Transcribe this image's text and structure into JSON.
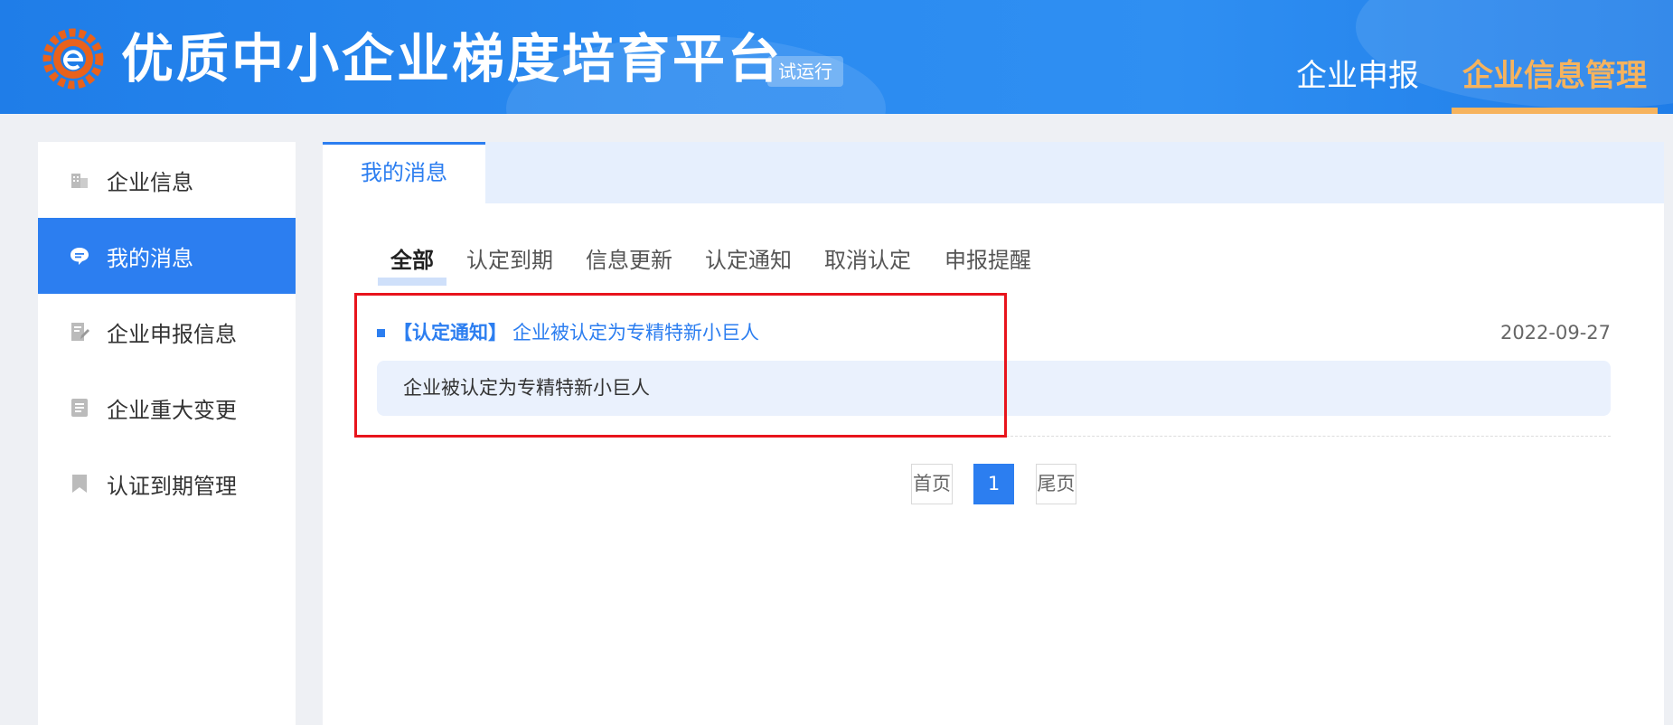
{
  "header": {
    "site_title": "优质中小企业梯度培育平台",
    "trial_badge": "试运行",
    "nav": [
      {
        "label": "企业申报",
        "active": false
      },
      {
        "label": "企业信息管理",
        "active": true
      }
    ]
  },
  "sidebar": {
    "items": [
      {
        "label": "企业信息",
        "icon": "building-icon",
        "active": false
      },
      {
        "label": "我的消息",
        "icon": "message-icon",
        "active": true
      },
      {
        "label": "企业申报信息",
        "icon": "edit-document-icon",
        "active": false
      },
      {
        "label": "企业重大变更",
        "icon": "document-icon",
        "active": false
      },
      {
        "label": "认证到期管理",
        "icon": "bookmark-icon",
        "active": false
      }
    ]
  },
  "main": {
    "tab": "我的消息",
    "filters": [
      "全部",
      "认定到期",
      "信息更新",
      "认定通知",
      "取消认定",
      "申报提醒"
    ],
    "active_filter": "全部",
    "messages": [
      {
        "tag": "【认定通知】",
        "title": "企业被认定为专精特新小巨人",
        "date": "2022-09-27",
        "body": "企业被认定为专精特新小巨人"
      }
    ],
    "pagination": {
      "first": "首页",
      "current": "1",
      "last": "尾页"
    }
  },
  "colors": {
    "header_blue": "#2a8af0",
    "accent_blue": "#2c7ef0",
    "nav_active_orange": "#f6b35d",
    "highlight_red": "#e8141c"
  }
}
